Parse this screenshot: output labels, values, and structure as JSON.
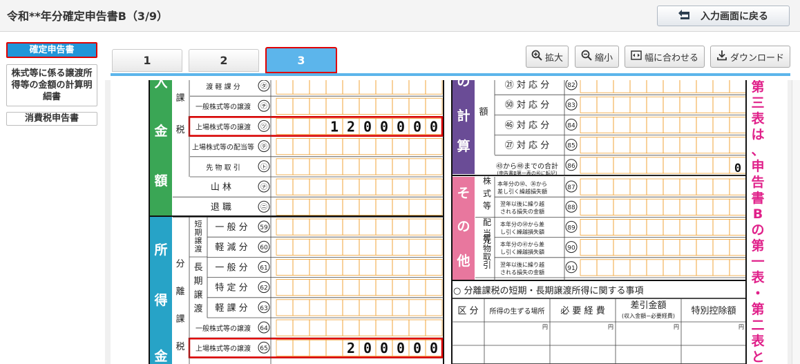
{
  "header": {
    "title": "令和**年分確定申告書B（3/9）",
    "back_button_label": "入力画面に戻る"
  },
  "sidebar": {
    "items": [
      {
        "label": "確定申告書",
        "active": true
      },
      {
        "label": "株式等に係る譲渡所得等の金額の計算明細書",
        "active": false
      },
      {
        "label": "消費税申告書",
        "active": false
      }
    ]
  },
  "tabs": [
    {
      "label": "1",
      "active": false
    },
    {
      "label": "2",
      "active": false
    },
    {
      "label": "3",
      "active": true
    }
  ],
  "toolbar": {
    "zoom_in": "拡大",
    "zoom_out": "縮小",
    "fit_width": "幅に合わせる",
    "download": "ダウンロード"
  },
  "form": {
    "left_section_top": {
      "vertical_chars": [
        "入",
        "金",
        "額"
      ],
      "sub_chars": [
        "課",
        "税"
      ],
      "rows": [
        {
          "label": "渡 軽 課 分",
          "num": "㋟",
          "value": ""
        },
        {
          "label": "一般株式等の譲渡",
          "num": "㋠",
          "value": ""
        },
        {
          "label": "上場株式等の譲渡",
          "num": "㋡",
          "value": "1200000",
          "highlight": true
        },
        {
          "label": "上場株式等の配当等",
          "num": "㋢",
          "value": ""
        },
        {
          "label": "先 物 取 引",
          "num": "㋣",
          "value": ""
        },
        {
          "label": "山 林",
          "num": "㋤",
          "value": ""
        },
        {
          "label": "退 職",
          "num": "㋥",
          "value": ""
        }
      ]
    },
    "left_section_bottom": {
      "vertical_chars": [
        "所",
        "得",
        "金"
      ],
      "sub_chars": [
        "分",
        "離",
        "課",
        "税"
      ],
      "short_term": "短期譲渡",
      "long_term": "長期譲渡",
      "rows": [
        {
          "label": "一 般 分",
          "num": "59",
          "value": ""
        },
        {
          "label": "軽 減 分",
          "num": "60",
          "value": ""
        },
        {
          "label": "一 般 分",
          "num": "61",
          "value": ""
        },
        {
          "label": "特 定 分",
          "num": "62",
          "value": ""
        },
        {
          "label": "軽 課 分",
          "num": "63",
          "value": ""
        },
        {
          "label": "一般株式等の譲渡",
          "num": "64",
          "value": ""
        },
        {
          "label": "上場株式等の譲渡",
          "num": "65",
          "value": "200000",
          "highlight": true
        }
      ]
    },
    "right_section_top": {
      "vertical_chars": [
        "の",
        "計",
        "算"
      ],
      "sub_char": "額",
      "rows": [
        {
          "label": "㉑ 対 応 分",
          "num": "82",
          "value": ""
        },
        {
          "label": "㊿ 対 応 分",
          "num": "83",
          "value": ""
        },
        {
          "label": "㊻ 対 応 分",
          "num": "84",
          "value": ""
        },
        {
          "label": "㉗ 対 応 分",
          "num": "85",
          "value": ""
        },
        {
          "label": "㊸から㊽までの合計",
          "sublabel": "(申告書B第一表の㊻に転記)",
          "num": "86",
          "value": "0"
        }
      ]
    },
    "right_section_bottom": {
      "vertical_chars": [
        "そ",
        "の",
        "他"
      ],
      "groups": [
        "株式等",
        "配当等",
        "先物取引"
      ],
      "rows": [
        {
          "label": "本年分の㊿、㊱から差し引く繰越損失額",
          "num": "87",
          "value": ""
        },
        {
          "label": "翌年以後に繰り越される損失の金額",
          "num": "88",
          "value": ""
        },
        {
          "label": "本年分の㊿から差し引く繰越損失額",
          "num": "89",
          "value": ""
        },
        {
          "label": "本年分の㊶から差し引く繰越損失額",
          "num": "90",
          "value": ""
        },
        {
          "label": "翌年以後に繰り越される損失の金額",
          "num": "91",
          "value": ""
        }
      ]
    },
    "separate_tax_section": {
      "title": "○ 分離課税の短期・長期譲渡所得に関する事項",
      "headers": [
        "区 分",
        "所得の生ずる場所",
        "必 要 経 費",
        "差引金額",
        "特別控除額"
      ],
      "header_sub": "(収入金額−必要経費)",
      "yen": "円"
    },
    "vertical_note": "第三表は、申告書Bの第一表・第二表と"
  },
  "colors": {
    "accent_blue": "#2196d9",
    "highlight_red": "#e00000",
    "green_band": "#3aa655",
    "teal_band": "#27a3c7",
    "purple_band": "#6a4c96",
    "pink_band": "#e8779e",
    "magenta_text": "#e0218a",
    "orange_grid": "#f0a030"
  }
}
